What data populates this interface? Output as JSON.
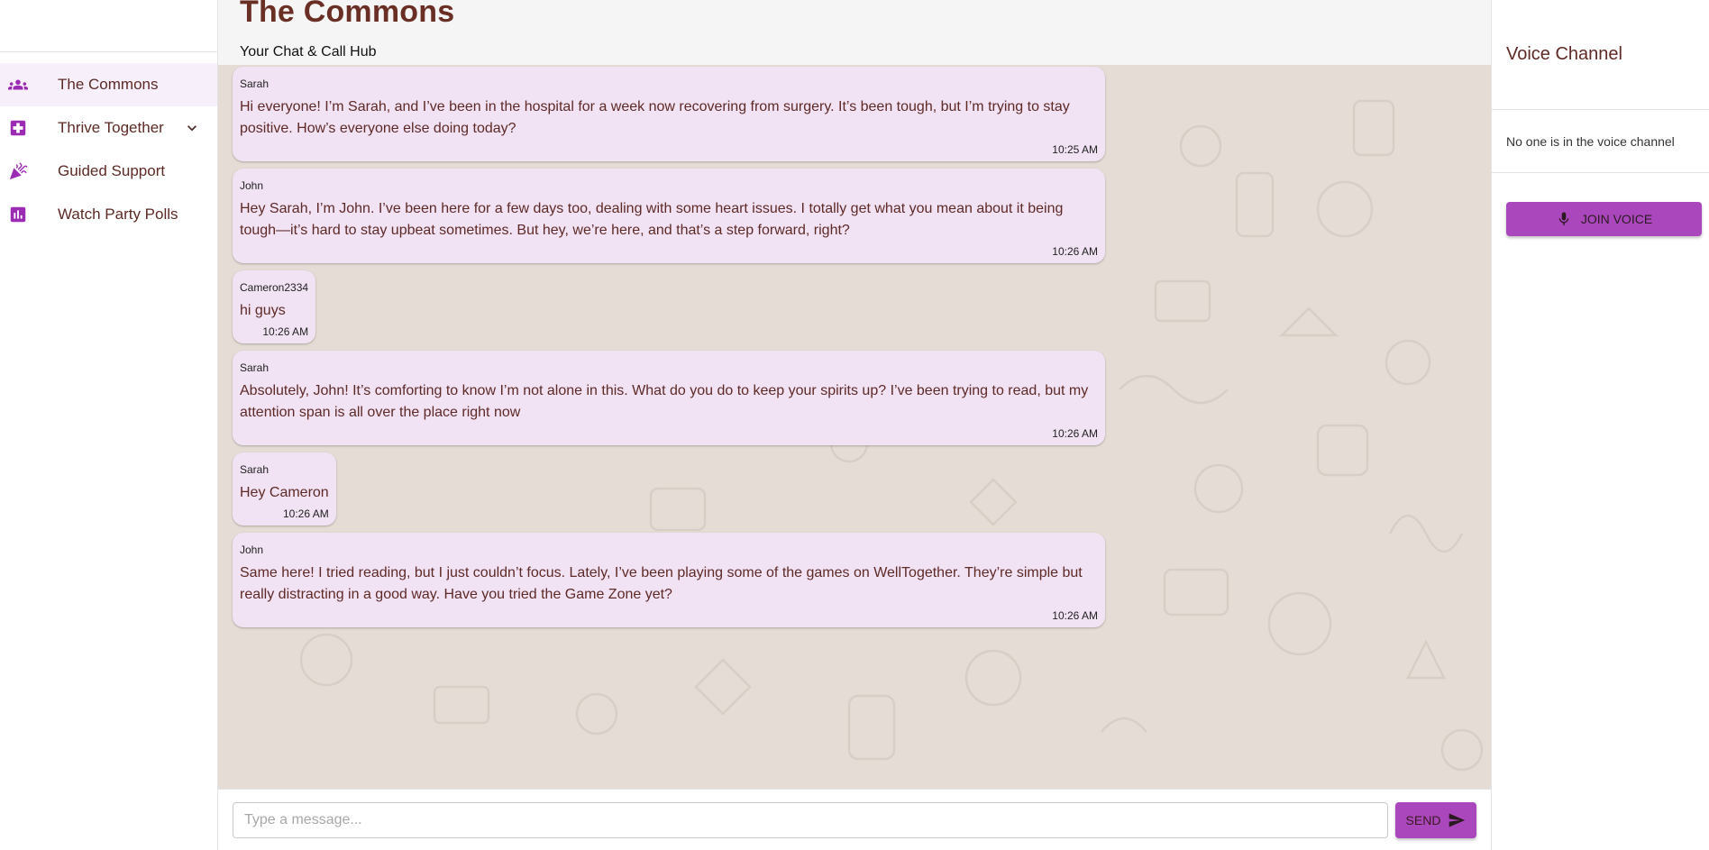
{
  "sidebar": {
    "items": [
      {
        "label": "The Commons",
        "icon": "groups-icon",
        "active": true
      },
      {
        "label": "Thrive Together",
        "icon": "medical-plus-icon",
        "expandable": true
      },
      {
        "label": "Guided Support",
        "icon": "celebration-icon"
      },
      {
        "label": "Watch Party Polls",
        "icon": "poll-icon"
      }
    ]
  },
  "header": {
    "title": "The Commons",
    "subtitle": "Your Chat & Call Hub"
  },
  "messages": [
    {
      "author": "Sarah",
      "text": "Hi everyone! I’m Sarah, and I’ve been in the hospital for a week now recovering from surgery. It’s been tough, but I’m trying to stay positive. How’s everyone else doing today?",
      "time": "10:25 AM"
    },
    {
      "author": "John",
      "text": "Hey Sarah, I’m John. I’ve been here for a few days too, dealing with some heart issues. I totally get what you mean about it being tough—it’s hard to stay upbeat sometimes. But hey, we’re here, and that’s a step forward, right?",
      "time": "10:26 AM"
    },
    {
      "author": "Cameron2334",
      "text": "hi guys",
      "time": "10:26 AM"
    },
    {
      "author": "Sarah",
      "text": "Absolutely, John! It’s comforting to know I’m not alone in this. What do you do to keep your spirits up? I’ve been trying to read, but my attention span is all over the place right now",
      "time": "10:26 AM"
    },
    {
      "author": "Sarah",
      "text": "Hey Cameron",
      "time": "10:26 AM"
    },
    {
      "author": "John",
      "text": "Same here! I tried reading, but I just couldn’t focus. Lately, I’ve been playing some of the games on WellTogether. They’re simple but really distracting in a good way. Have you tried the Game Zone yet?",
      "time": "10:26 AM"
    }
  ],
  "composer": {
    "placeholder": "Type a message...",
    "send_label": "SEND"
  },
  "voice": {
    "title": "Voice Channel",
    "empty_text": "No one is in the voice channel",
    "join_label": "JOIN VOICE"
  },
  "colors": {
    "accent": "#ab47bc",
    "icon": "#9c2bb3",
    "bubble": "#f1e2f4",
    "chat_bg": "#e5ddd5",
    "text": "#5d2a26"
  }
}
